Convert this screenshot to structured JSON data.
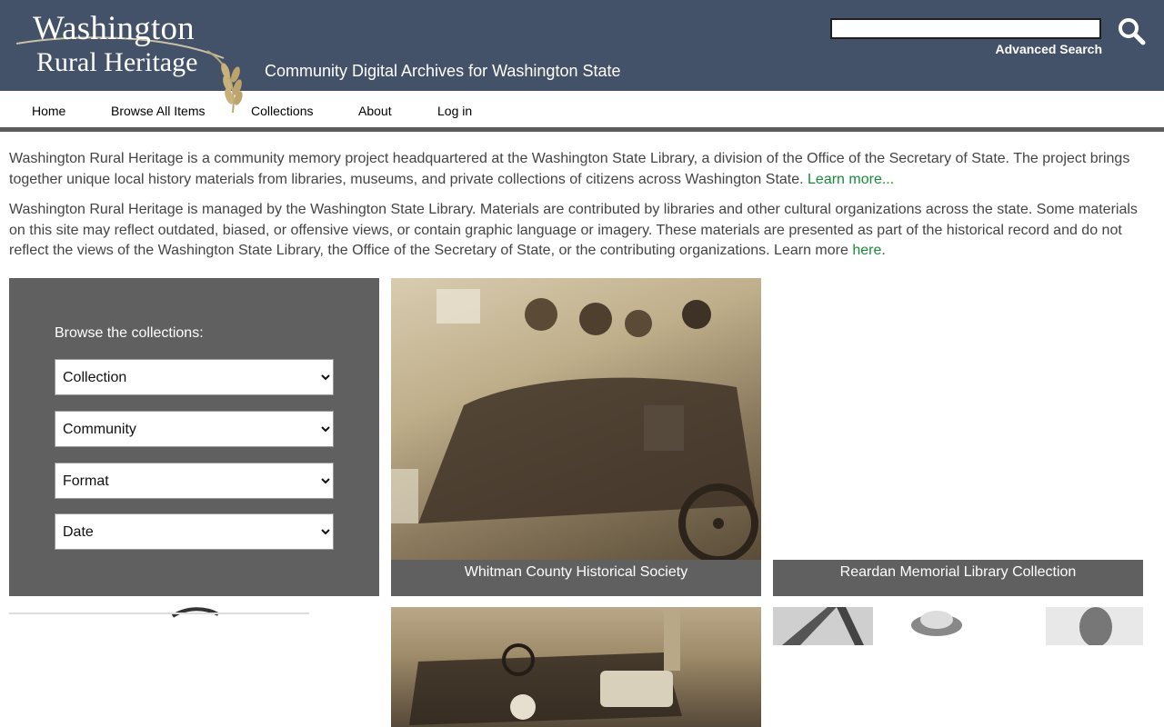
{
  "header": {
    "logo_line1": "Washington",
    "logo_line2": "Rural Heritage",
    "tagline": "Community Digital Archives for Washington State",
    "search_value": "",
    "advanced_search": "Advanced Search",
    "search_icon": "search-icon",
    "bg_color": "#435169"
  },
  "nav": {
    "items": [
      "Home",
      "Browse All Items",
      "Collections",
      "About",
      "Log in"
    ]
  },
  "intro": {
    "p1_text": "Washington Rural Heritage is a community memory project headquartered at the Washington State Library, a division of the Office of the Secretary of State. The project brings together unique local history materials from libraries, museums, and private collections of citizens across Washington State. ",
    "p1_link": "Learn more...",
    "p2_text": "Washington Rural Heritage is managed by the Washington State Library. Materials are contributed by libraries and other cultural organizations across the state. Some materials on this site may reflect outdated, biased, or offensive views, or contain graphic language or imagery. These materials are presented as part of the historical record and do not reflect the views of the Washington State Library, the Office of the Secretary of State, or the contributing organizations. Learn more ",
    "p2_link": "here",
    "p2_end": ".",
    "link_color": "#1a8a3a"
  },
  "browse": {
    "title": "Browse the collections:",
    "selects": [
      "Collection",
      "Community",
      "Format",
      "Date"
    ]
  },
  "collections": [
    {
      "caption": "Whitman County Historical Society"
    },
    {
      "caption": "Reardan Memorial Library Collection"
    }
  ]
}
